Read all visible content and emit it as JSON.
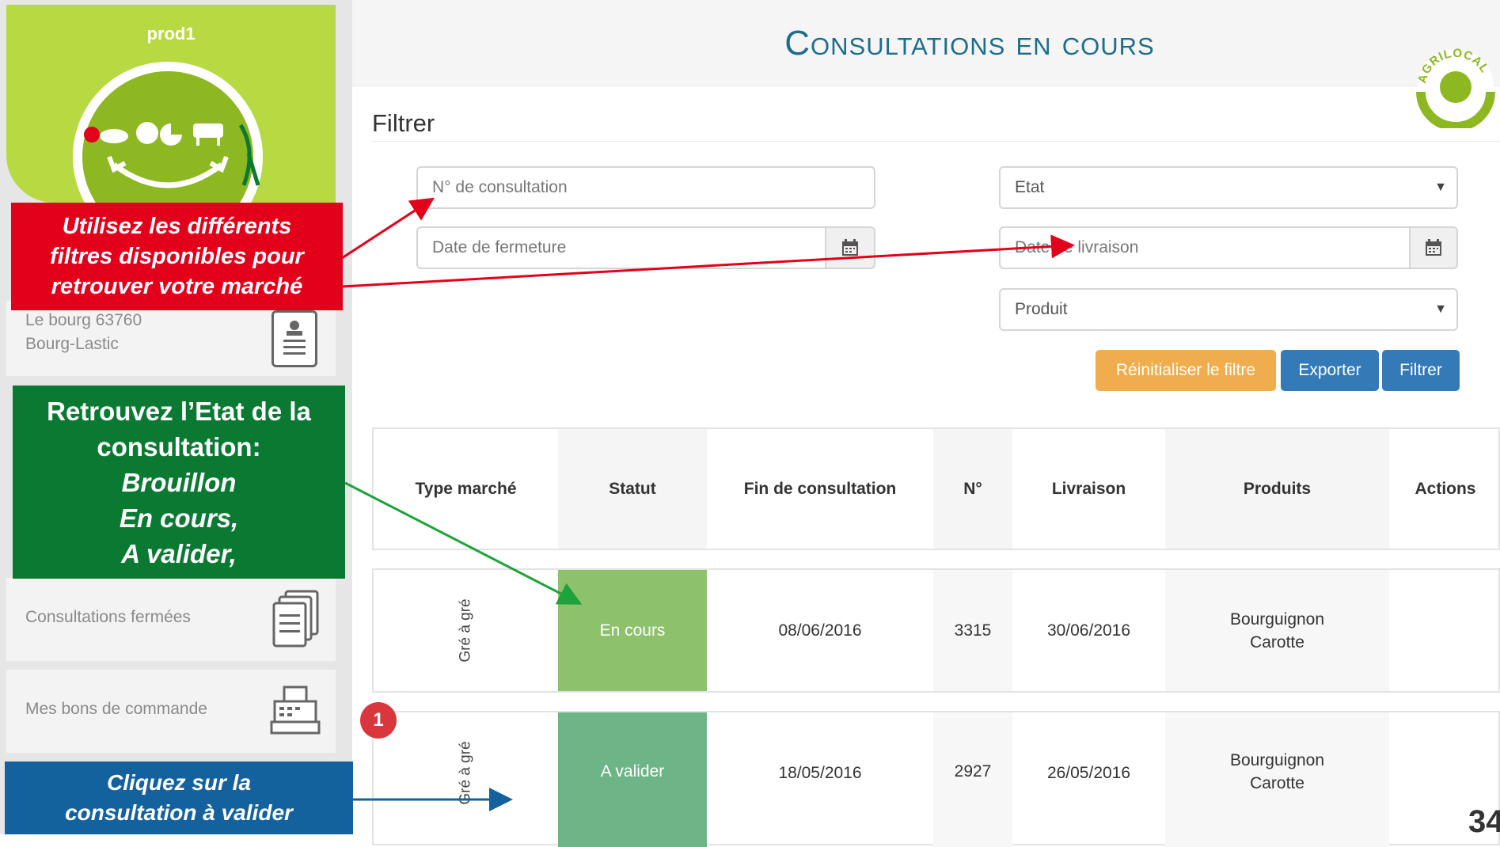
{
  "profile": {
    "name": "prod1"
  },
  "sidebar": {
    "address_line1": "Le bourg 63760",
    "address_line2": "Bourg-Lastic",
    "items": [
      {
        "label": "Consultations fermées"
      },
      {
        "label": "Mes bons de commande"
      }
    ]
  },
  "header": {
    "title": "Consultations en cours",
    "brand": "AGRILOCAL"
  },
  "filters": {
    "title": "Filtrer",
    "consultation_no_placeholder": "N° de consultation",
    "closing_date_placeholder": "Date de fermeture",
    "state_selected": "Etat",
    "delivery_date_placeholder": "Date de livraison",
    "product_selected": "Produit",
    "reset_label": "Réinitialiser le filtre",
    "export_label": "Exporter",
    "filter_label": "Filtrer"
  },
  "table": {
    "headers": [
      "Type marché",
      "Statut",
      "Fin de consultation",
      "N°",
      "Livraison",
      "Produits",
      "Actions"
    ],
    "rows": [
      {
        "type": "Gré à gré",
        "status": "En cours",
        "end_date": "08/06/2016",
        "number": "3315",
        "delivery": "30/06/2016",
        "product_line1": "Bourguignon",
        "product_line2": "Carotte"
      },
      {
        "type": "Gré à gré",
        "status": "A valider",
        "end_date": "18/05/2016",
        "number": "2927",
        "delivery": "26/05/2016",
        "product_line1": "Bourguignon",
        "product_line2": "Carotte"
      }
    ]
  },
  "callouts": {
    "filters": [
      "Utilisez les différents",
      "filtres disponibles pour",
      "retrouver votre marché"
    ],
    "state_heading_1": "Retrouvez l’Etat de la",
    "state_heading_2": "consultation:",
    "state_items": [
      "Brouillon",
      "En cours,",
      "A valider,"
    ],
    "click": [
      "Cliquez sur la",
      "consultation à valider"
    ]
  },
  "badge_count": "1",
  "page_number": "34",
  "colors": {
    "title_blue": "#1f6d8b",
    "status_en_cours": "#8dc16c",
    "status_a_valider": "#6db586",
    "btn_reset": "#f0ad4e",
    "btn_primary": "#337ab7",
    "callout_red": "#e3001b",
    "callout_green": "#0a7a33",
    "callout_blue": "#13629e",
    "profile_green": "#b7d941"
  }
}
